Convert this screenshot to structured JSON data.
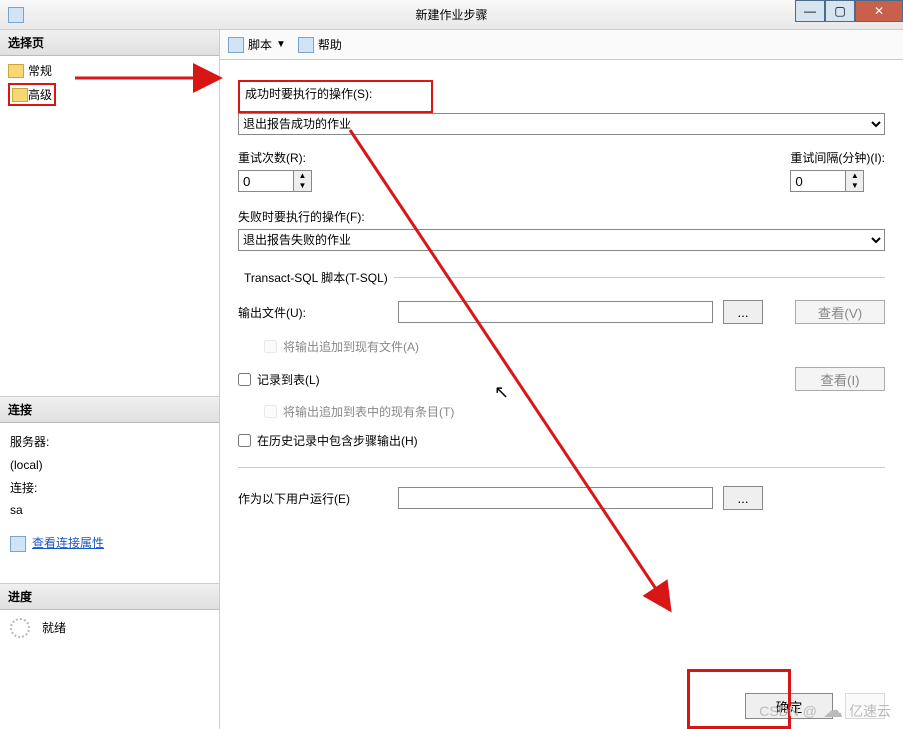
{
  "window": {
    "title": "新建作业步骤"
  },
  "sidebar": {
    "header": "选择页",
    "items": [
      {
        "label": "常规"
      },
      {
        "label": "高级"
      }
    ]
  },
  "connection": {
    "header": "连接",
    "server_label": "服务器:",
    "server_value": "(local)",
    "conn_label": "连接:",
    "conn_value": "sa",
    "view_props": "查看连接属性"
  },
  "progress": {
    "header": "进度",
    "status": "就绪"
  },
  "toolbar": {
    "script": "脚本",
    "help": "帮助"
  },
  "form": {
    "success_label": "成功时要执行的操作(S):",
    "success_value": "退出报告成功的作业",
    "retry_count_label": "重试次数(R):",
    "retry_count_value": "0",
    "retry_interval_label": "重试间隔(分钟)(I):",
    "retry_interval_value": "0",
    "fail_label": "失败时要执行的操作(F):",
    "fail_value": "退出报告失败的作业",
    "tsql_legend": "Transact-SQL 脚本(T-SQL)",
    "output_file_label": "输出文件(U):",
    "append_file": "将输出追加到现有文件(A)",
    "log_table": "记录到表(L)",
    "append_table": "将输出追加到表中的现有条目(T)",
    "include_history": "在历史记录中包含步骤输出(H)",
    "run_as_label": "作为以下用户运行(E)",
    "view_btn_v": "查看(V)",
    "view_btn_i": "查看(I)",
    "browse": "...",
    "ok": "确定"
  },
  "watermark": {
    "csdn": "CSDN @",
    "brand": "亿速云"
  }
}
